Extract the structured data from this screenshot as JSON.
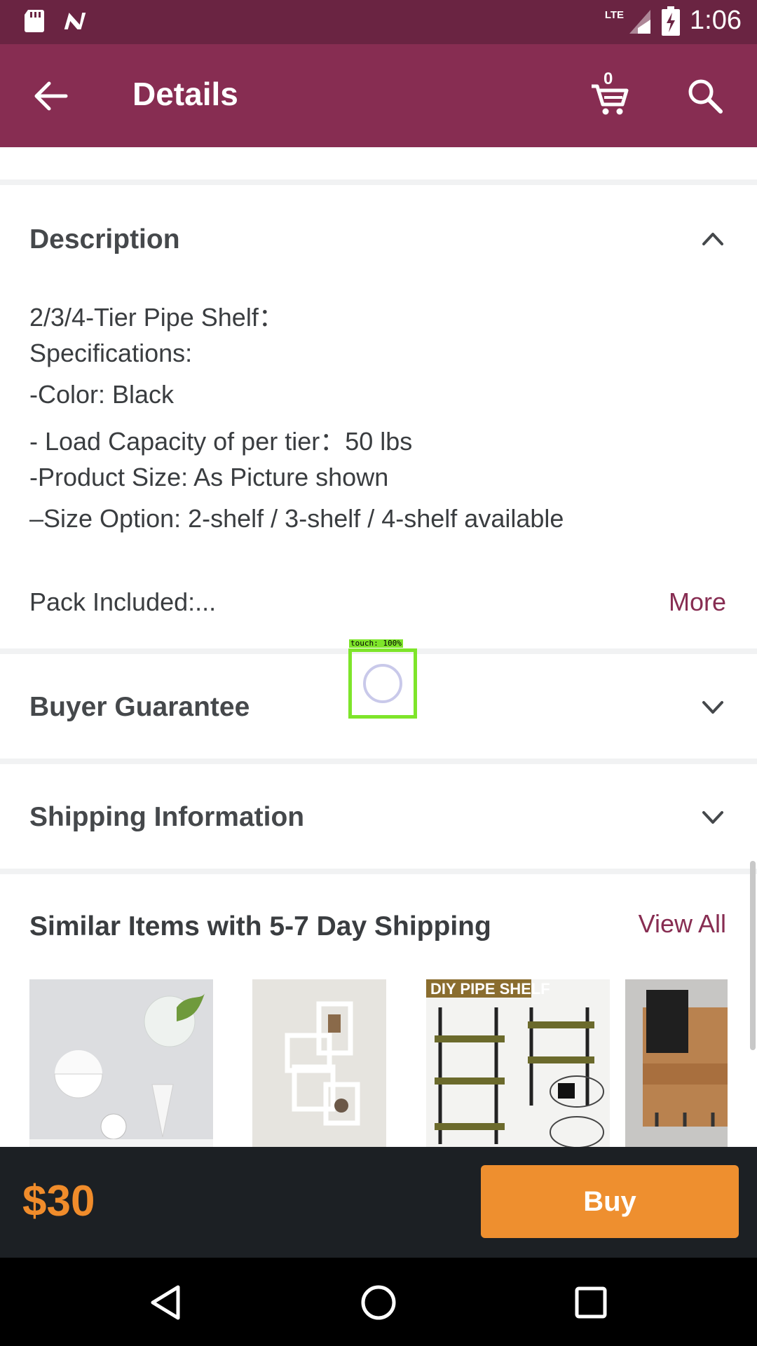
{
  "status_bar": {
    "time": "1:06",
    "network": "LTE",
    "icons": [
      "sd-card-icon",
      "n-notification-icon",
      "signal-icon",
      "battery-charging-icon"
    ]
  },
  "app_bar": {
    "title": "Details",
    "cart_count": "0",
    "icons": [
      "back-arrow-icon",
      "cart-icon",
      "search-icon"
    ]
  },
  "description": {
    "title": "Description",
    "lines": [
      "2/3/4-Tier Pipe Shelf：",
      "Specifications:",
      "-Color: Black",
      "- Load Capacity of per tier：50 lbs",
      "-Product Size: As Picture shown",
      "–Size Option: 2-shelf / 3-shelf / 4-shelf  available"
    ],
    "pack_line": "Pack Included:...",
    "more_label": "More"
  },
  "buyer_guarantee": {
    "title": "Buyer Guarantee"
  },
  "shipping_info": {
    "title": "Shipping Information"
  },
  "similar": {
    "title": "Similar Items with 5-7 Day Shipping",
    "view_all_label": "View All",
    "thumb3_text": "DIY PIPE SHELF"
  },
  "touch_indicator": {
    "label": "touch: 100%"
  },
  "buy_bar": {
    "price": "$30",
    "buy_label": "Buy"
  },
  "colors": {
    "status_bar": "#6a2442",
    "app_bar": "#872d52",
    "accent_link": "#872d52",
    "price": "#f08c2b",
    "buy_button": "#ee8f2f",
    "buy_bar_bg": "#1c2024"
  }
}
